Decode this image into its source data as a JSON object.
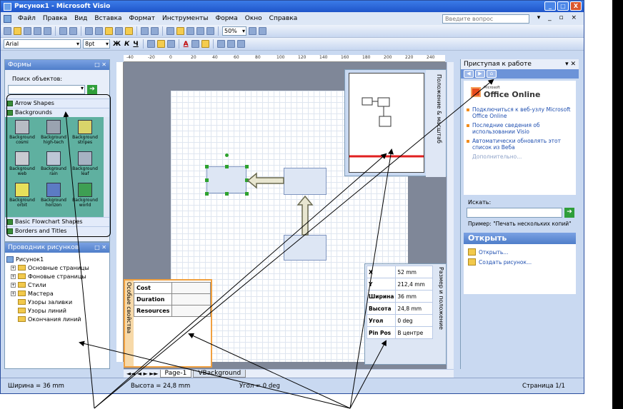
{
  "window": {
    "title": "Рисунок1 - Microsoft Visio",
    "controls": [
      "_",
      "□",
      "X"
    ]
  },
  "menubar": {
    "items": [
      "Файл",
      "Правка",
      "Вид",
      "Вставка",
      "Формат",
      "Инструменты",
      "Форма",
      "Окно",
      "Справка"
    ],
    "ask_placeholder": "Введите вопрос",
    "doc_controls": "▾ _ ▫ ×"
  },
  "toolbar1": {
    "zoom": "50%"
  },
  "toolbar2": {
    "font": "Arial",
    "size": "8pt",
    "bold": "Ж",
    "italic": "К",
    "underline": "Ч",
    "font_color": "A"
  },
  "shapes_panel": {
    "title": "Формы",
    "search_label": "Поиск объектов:",
    "stencils": [
      "Arrow Shapes",
      "Backgrounds",
      "Basic Flowchart Shapes",
      "Borders and Titles"
    ],
    "gallery": [
      {
        "label": "Background cosmi",
        "color": "#b7bcc4"
      },
      {
        "label": "Background high-tech",
        "color": "#9aa3b0"
      },
      {
        "label": "Background stripes",
        "color": "#d9d46a"
      },
      {
        "label": "Background web",
        "color": "#c9cbd1"
      },
      {
        "label": "Background rain",
        "color": "#bcc7d6"
      },
      {
        "label": "Background leaf",
        "color": "#a6b2c2"
      },
      {
        "label": "Background orbit",
        "color": "#e8e05a"
      },
      {
        "label": "Background horizon",
        "color": "#5c7bc4"
      },
      {
        "label": "Background world",
        "color": "#3e9f53"
      }
    ]
  },
  "explorer": {
    "title": "Проводник рисунков",
    "root": "Рисунок1",
    "items": [
      {
        "label": "Основные страницы",
        "expander": "+"
      },
      {
        "label": "Фоновые страницы",
        "expander": "+"
      },
      {
        "label": "Стили",
        "expander": "+"
      },
      {
        "label": "Мастера",
        "expander": "+"
      },
      {
        "label": "Узоры заливки",
        "expander": ""
      },
      {
        "label": "Узоры линий",
        "expander": ""
      },
      {
        "label": "Окончания линий",
        "expander": ""
      }
    ]
  },
  "ruler": {
    "labels": [
      "-40",
      "-20",
      "0",
      "20",
      "40",
      "60",
      "80",
      "100",
      "120",
      "140",
      "160",
      "180",
      "200",
      "220",
      "240"
    ]
  },
  "panzoom": {
    "title": "Положение & масштаб"
  },
  "size_position": {
    "title": "Размер и положение",
    "rows": [
      {
        "key": "X",
        "value": "52 mm"
      },
      {
        "key": "Y",
        "value": "212,4 mm"
      },
      {
        "key": "Ширина",
        "value": "36 mm"
      },
      {
        "key": "Высота",
        "value": "24,8 mm"
      },
      {
        "key": "Угол",
        "value": "0 deg"
      },
      {
        "key": "Pin Pos",
        "value": "В центре"
      }
    ]
  },
  "props": {
    "title": "Особые свойства",
    "rows": [
      "Cost",
      "Duration",
      "Resources"
    ]
  },
  "tabs": {
    "page1": "Page-1",
    "background": "VBackground"
  },
  "taskpane": {
    "title": "Приступая к работе",
    "logo_small": "Microsoft",
    "logo": "Office Online",
    "links": [
      "Подключиться к веб-узлу Microsoft Office Online",
      "Последние сведения об использовании Visio",
      "Автоматически обновлять этот список из Веба"
    ],
    "more": "Дополнительно...",
    "search_label": "Искать:",
    "example": "Пример: \"Печать нескольких копий\"",
    "open_title": "Открыть",
    "open_links": [
      "Открыть...",
      "Создать рисунок..."
    ]
  },
  "status": {
    "width": "Ширина = 36 mm",
    "height": "Высота = 24,8 mm",
    "angle": "Угол = 0 deg",
    "page": "Страница 1/1"
  },
  "colors": {
    "title_bar": "#1f55c9",
    "panel_header": "#4f7ec9",
    "props_border": "#f0a040",
    "highlight_line": "#e02020"
  }
}
